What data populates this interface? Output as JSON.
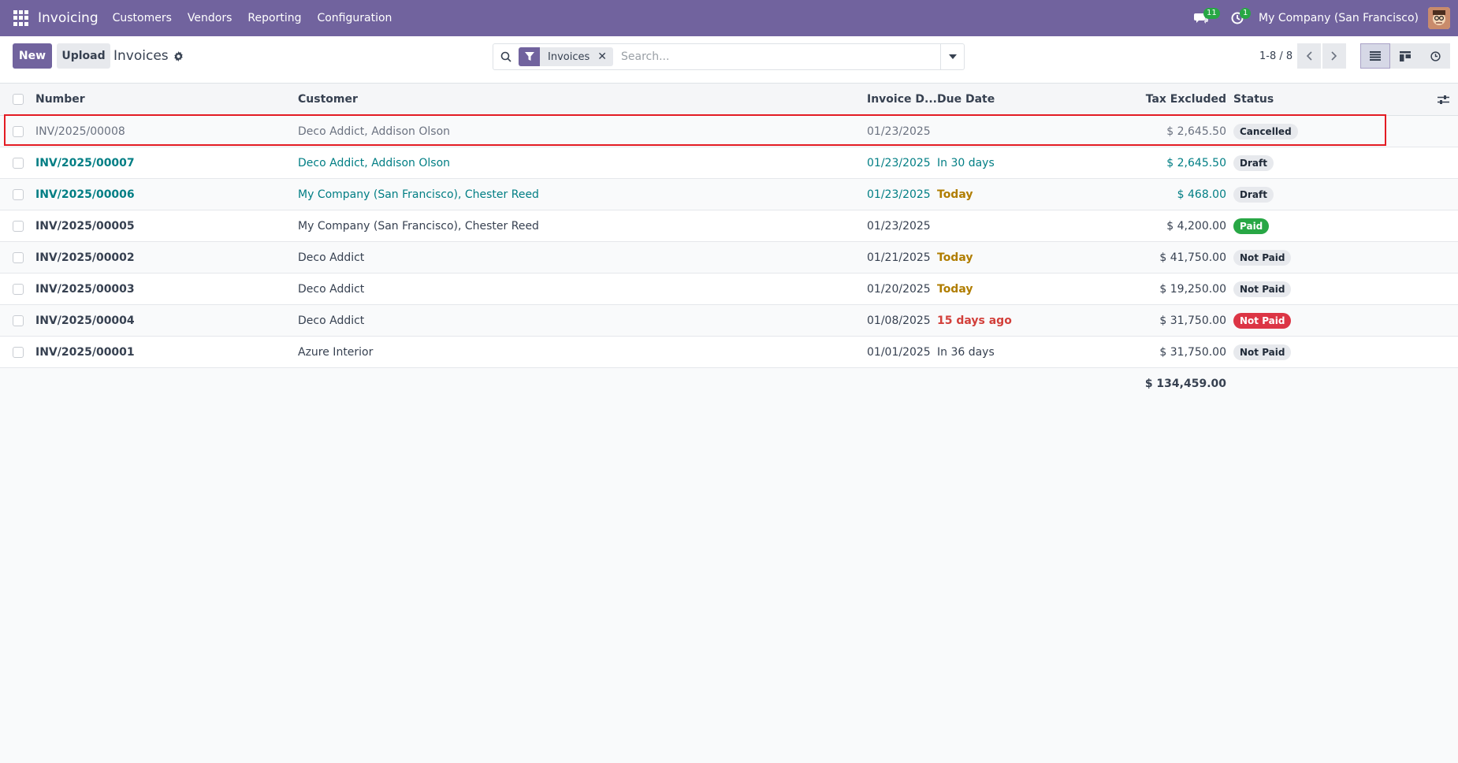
{
  "navbar": {
    "app_name": "Invoicing",
    "menu": [
      "Customers",
      "Vendors",
      "Reporting",
      "Configuration"
    ],
    "messages_count": "11",
    "activities_count": "1",
    "company": "My Company (San Francisco)"
  },
  "control": {
    "new_label": "New",
    "upload_label": "Upload",
    "breadcrumb": "Invoices",
    "facet_label": "Invoices",
    "search_placeholder": "Search...",
    "pager": "1-8 / 8"
  },
  "table": {
    "headers": {
      "number": "Number",
      "customer": "Customer",
      "invoice_date": "Invoice D...",
      "due_date": "Due Date",
      "tax_excluded": "Tax Excluded",
      "status": "Status"
    },
    "rows": [
      {
        "number": "INV/2025/00008",
        "customer": "Deco Addict, Addison Olson",
        "invoice_date": "01/23/2025",
        "due_date": "",
        "tax_excluded": "$ 2,645.50",
        "status": "Cancelled"
      },
      {
        "number": "INV/2025/00007",
        "customer": "Deco Addict, Addison Olson",
        "invoice_date": "01/23/2025",
        "due_date": "In 30 days",
        "tax_excluded": "$ 2,645.50",
        "status": "Draft"
      },
      {
        "number": "INV/2025/00006",
        "customer": "My Company (San Francisco), Chester Reed",
        "invoice_date": "01/23/2025",
        "due_date": "Today",
        "tax_excluded": "$ 468.00",
        "status": "Draft"
      },
      {
        "number": "INV/2025/00005",
        "customer": "My Company (San Francisco), Chester Reed",
        "invoice_date": "01/23/2025",
        "due_date": "",
        "tax_excluded": "$ 4,200.00",
        "status": "Paid"
      },
      {
        "number": "INV/2025/00002",
        "customer": "Deco Addict",
        "invoice_date": "01/21/2025",
        "due_date": "Today",
        "tax_excluded": "$ 41,750.00",
        "status": "Not Paid"
      },
      {
        "number": "INV/2025/00003",
        "customer": "Deco Addict",
        "invoice_date": "01/20/2025",
        "due_date": "Today",
        "tax_excluded": "$ 19,250.00",
        "status": "Not Paid"
      },
      {
        "number": "INV/2025/00004",
        "customer": "Deco Addict",
        "invoice_date": "01/08/2025",
        "due_date": "15 days ago",
        "tax_excluded": "$ 31,750.00",
        "status": "Not Paid"
      },
      {
        "number": "INV/2025/00001",
        "customer": "Azure Interior",
        "invoice_date": "01/01/2025",
        "due_date": "In 36 days",
        "tax_excluded": "$ 31,750.00",
        "status": "Not Paid"
      }
    ],
    "total": "$ 134,459.00"
  },
  "colors": {
    "brand": "#71639e",
    "link": "#017e84",
    "warning": "#b07d00",
    "danger": "#d23f3a",
    "paid": "#28a745",
    "highlight": "#e31b23"
  }
}
